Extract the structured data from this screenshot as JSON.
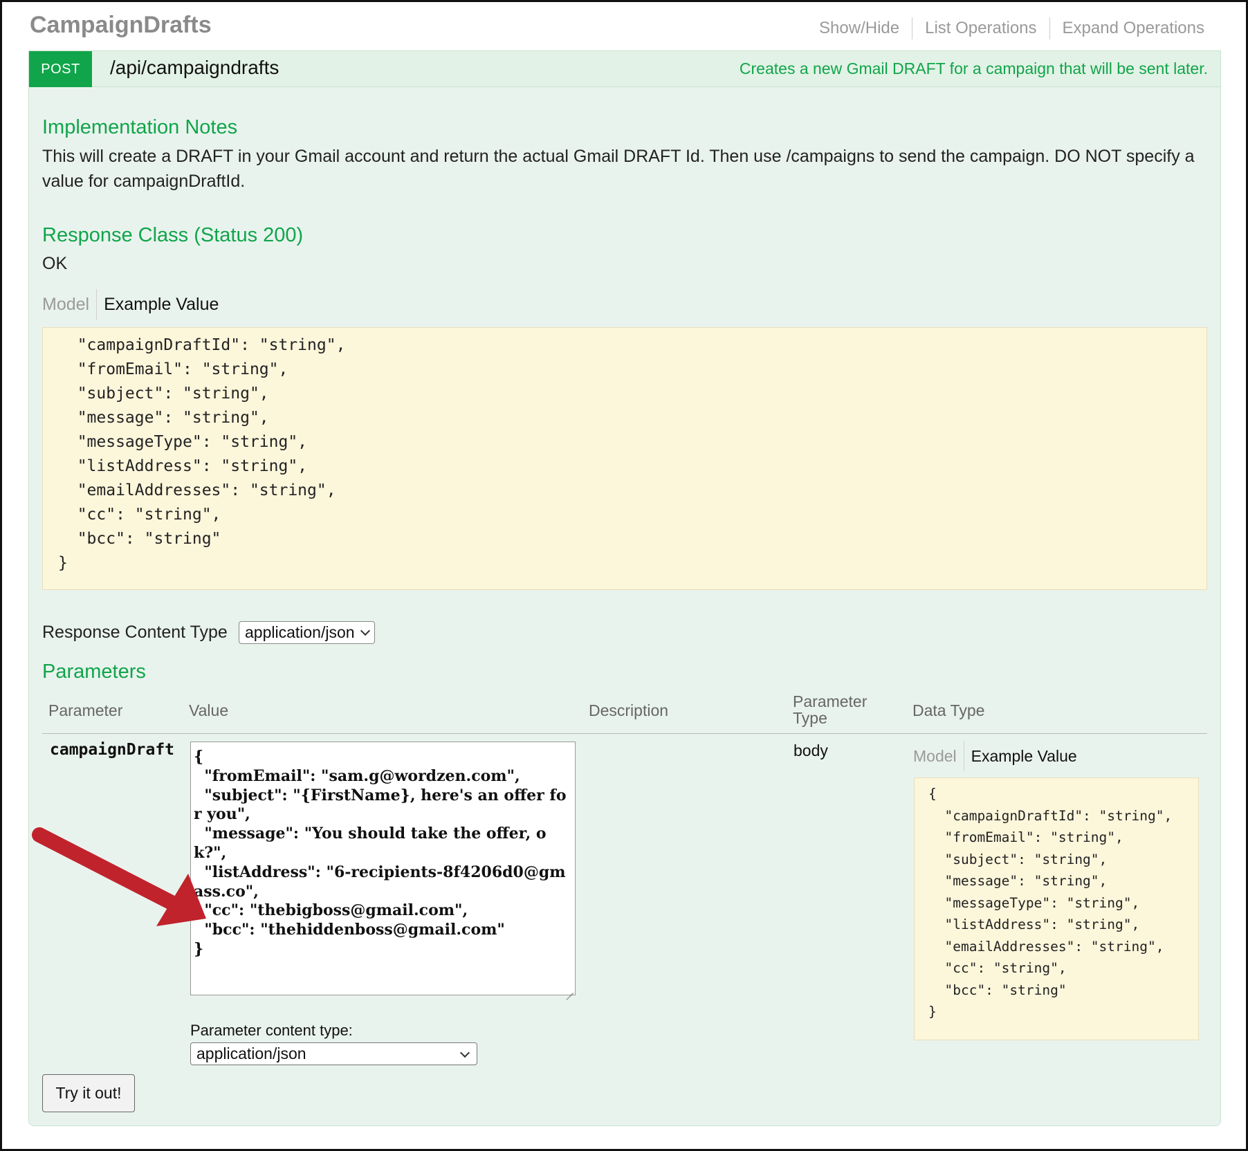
{
  "resource": {
    "title": "CampaignDrafts",
    "links": [
      "Show/Hide",
      "List Operations",
      "Expand Operations"
    ]
  },
  "operation": {
    "method": "POST",
    "path": "/api/campaigndrafts",
    "summary": "Creates a new Gmail DRAFT for a campaign that will be sent later."
  },
  "implementation": {
    "heading": "Implementation Notes",
    "text": "This will create a DRAFT in your Gmail account and return the actual Gmail DRAFT Id. Then use /campaigns to send the campaign. DO NOT specify a value for campaignDraftId."
  },
  "response_class": {
    "heading": "Response Class (Status 200)",
    "status_text": "OK",
    "tab_model": "Model",
    "tab_example": "Example Value",
    "example": "  \"campaignDraftId\": \"string\",\n  \"fromEmail\": \"string\",\n  \"subject\": \"string\",\n  \"message\": \"string\",\n  \"messageType\": \"string\",\n  \"listAddress\": \"string\",\n  \"emailAddresses\": \"string\",\n  \"cc\": \"string\",\n  \"bcc\": \"string\"\n}"
  },
  "response_content_type": {
    "label": "Response Content Type",
    "value": "application/json"
  },
  "parameters": {
    "heading": "Parameters",
    "columns": {
      "parameter": "Parameter",
      "value": "Value",
      "description": "Description",
      "parameter_type": "Parameter Type",
      "data_type": "Data Type"
    },
    "row": {
      "name": "campaignDraft",
      "value": "{\n  \"fromEmail\": \"sam.g@wordzen.com\",\n  \"subject\": \"{FirstName}, here's an offer for you\",\n  \"message\": \"You should take the offer, ok?\",\n  \"listAddress\": \"6-recipients-8f4206d0@gmass.co\",\n  \"cc\": \"thebigboss@gmail.com\",\n  \"bcc\": \"thehiddenboss@gmail.com\"\n}",
      "parameter_type": "body",
      "tab_model": "Model",
      "tab_example": "Example Value",
      "example": "{\n  \"campaignDraftId\": \"string\",\n  \"fromEmail\": \"string\",\n  \"subject\": \"string\",\n  \"message\": \"string\",\n  \"messageType\": \"string\",\n  \"listAddress\": \"string\",\n  \"emailAddresses\": \"string\",\n  \"cc\": \"string\",\n  \"bcc\": \"string\"\n}"
    },
    "content_type_label": "Parameter content type:",
    "content_type_value": "application/json"
  },
  "try_button": "Try it out!",
  "colors": {
    "accent_green": "#10a54a",
    "panel_bg": "#e9f3ee",
    "code_bg": "#fcf6db",
    "arrow_red": "#c0232c"
  },
  "icons": [
    "chevron-down-icon",
    "resize-grip-icon",
    "red-arrow-annotation"
  ]
}
